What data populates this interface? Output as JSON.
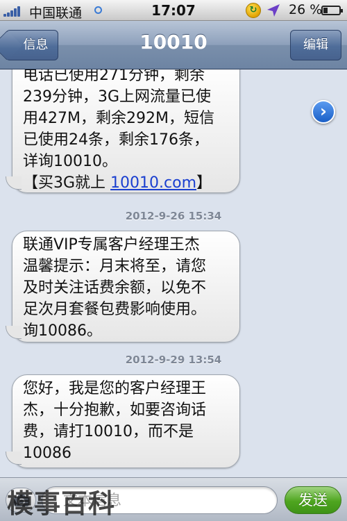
{
  "status_bar": {
    "carrier": "中国联通",
    "time": "17:07",
    "battery_percent_text": "26 %",
    "battery_level": 0.26,
    "signal_bars": 5,
    "icons": [
      "signal-bars-icon",
      "activity-ring-icon",
      "sync-icon",
      "location-arrow-icon",
      "battery-icon"
    ]
  },
  "nav_bar": {
    "back_label": "信息",
    "title": "10010",
    "edit_label": "编辑"
  },
  "messages": [
    {
      "lines": [
        "电话已使用271分钟，剩余",
        "239分钟，3G上网流量已使",
        "用427M，剩余292M，短信",
        "已使用24条，剩余176条，",
        "详询10010。"
      ],
      "link_prefix": "【买3G就上 ",
      "link_text": "10010.com",
      "link_suffix": "】"
    },
    {
      "lines": [
        "联通VIP专属客户经理王杰",
        "温馨提示：月末将至，请您",
        "及时关注话费余额，以免不",
        "足次月套餐包费影响使用。",
        "询10086。"
      ]
    },
    {
      "lines": [
        "您好，我是您的客户经理王",
        "杰，十分抱歉，如要咨询话",
        "费，请打10010，而不是",
        "10086"
      ]
    }
  ],
  "timestamps": [
    "2012-9-26 15:34",
    "2012-9-29 13:54"
  ],
  "input_bar": {
    "placeholder": "文本信息",
    "send_label": "发送"
  },
  "watermark": "模事百科",
  "colors": {
    "nav_blue": "#6d84a3",
    "link_blue": "#1a3fd0",
    "send_green": "#4ea51f",
    "timestamp_gray": "#7e8796"
  }
}
